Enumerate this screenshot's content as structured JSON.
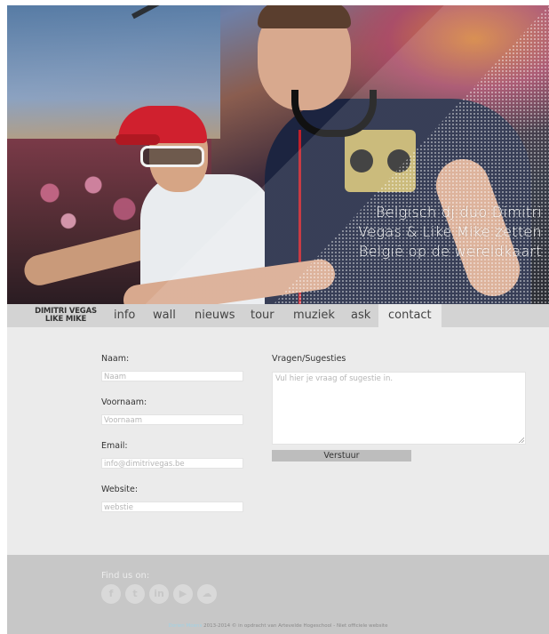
{
  "hero": {
    "tagline_lines": [
      "Belgisch dj duo Dimitri",
      "Vegas & Like Mike zetten",
      "België op de wereldkaart"
    ]
  },
  "nav": {
    "logo_line1": "DIMITRI VEGAS",
    "logo_line2": "LIKE MIKE",
    "items": [
      "info",
      "wall",
      "nieuws",
      "tour",
      "muziek",
      "ask",
      "contact"
    ],
    "active": "contact"
  },
  "form": {
    "naam_label": "Naam:",
    "naam_placeholder": "Naam",
    "voornaam_label": "Voornaam:",
    "voornaam_placeholder": "Voornaam",
    "email_label": "Email:",
    "email_placeholder": "info@dimitrivegas.be",
    "website_label": "Website:",
    "website_placeholder": "webstie",
    "vragen_label": "Vragen/Sugesties",
    "vragen_placeholder": "Vul hier je vraag of sugestie in.",
    "submit_label": "Verstuur"
  },
  "footer": {
    "find_us": "Find us on:",
    "social_icons": [
      "facebook-icon",
      "twitter-icon",
      "linkedin-icon",
      "youtube-icon",
      "soundcloud-icon"
    ],
    "credit_name": "Dorien Moens",
    "copyright_rest": " 2013-2014 © in opdracht van Artevelde Hogeschool - Niet officiele website"
  },
  "colors": {
    "nav_bg": "#d3d3d3",
    "form_bg": "#ebebeb",
    "footer_bg": "#c7c7c7",
    "credit_link": "#9fd2e6"
  }
}
